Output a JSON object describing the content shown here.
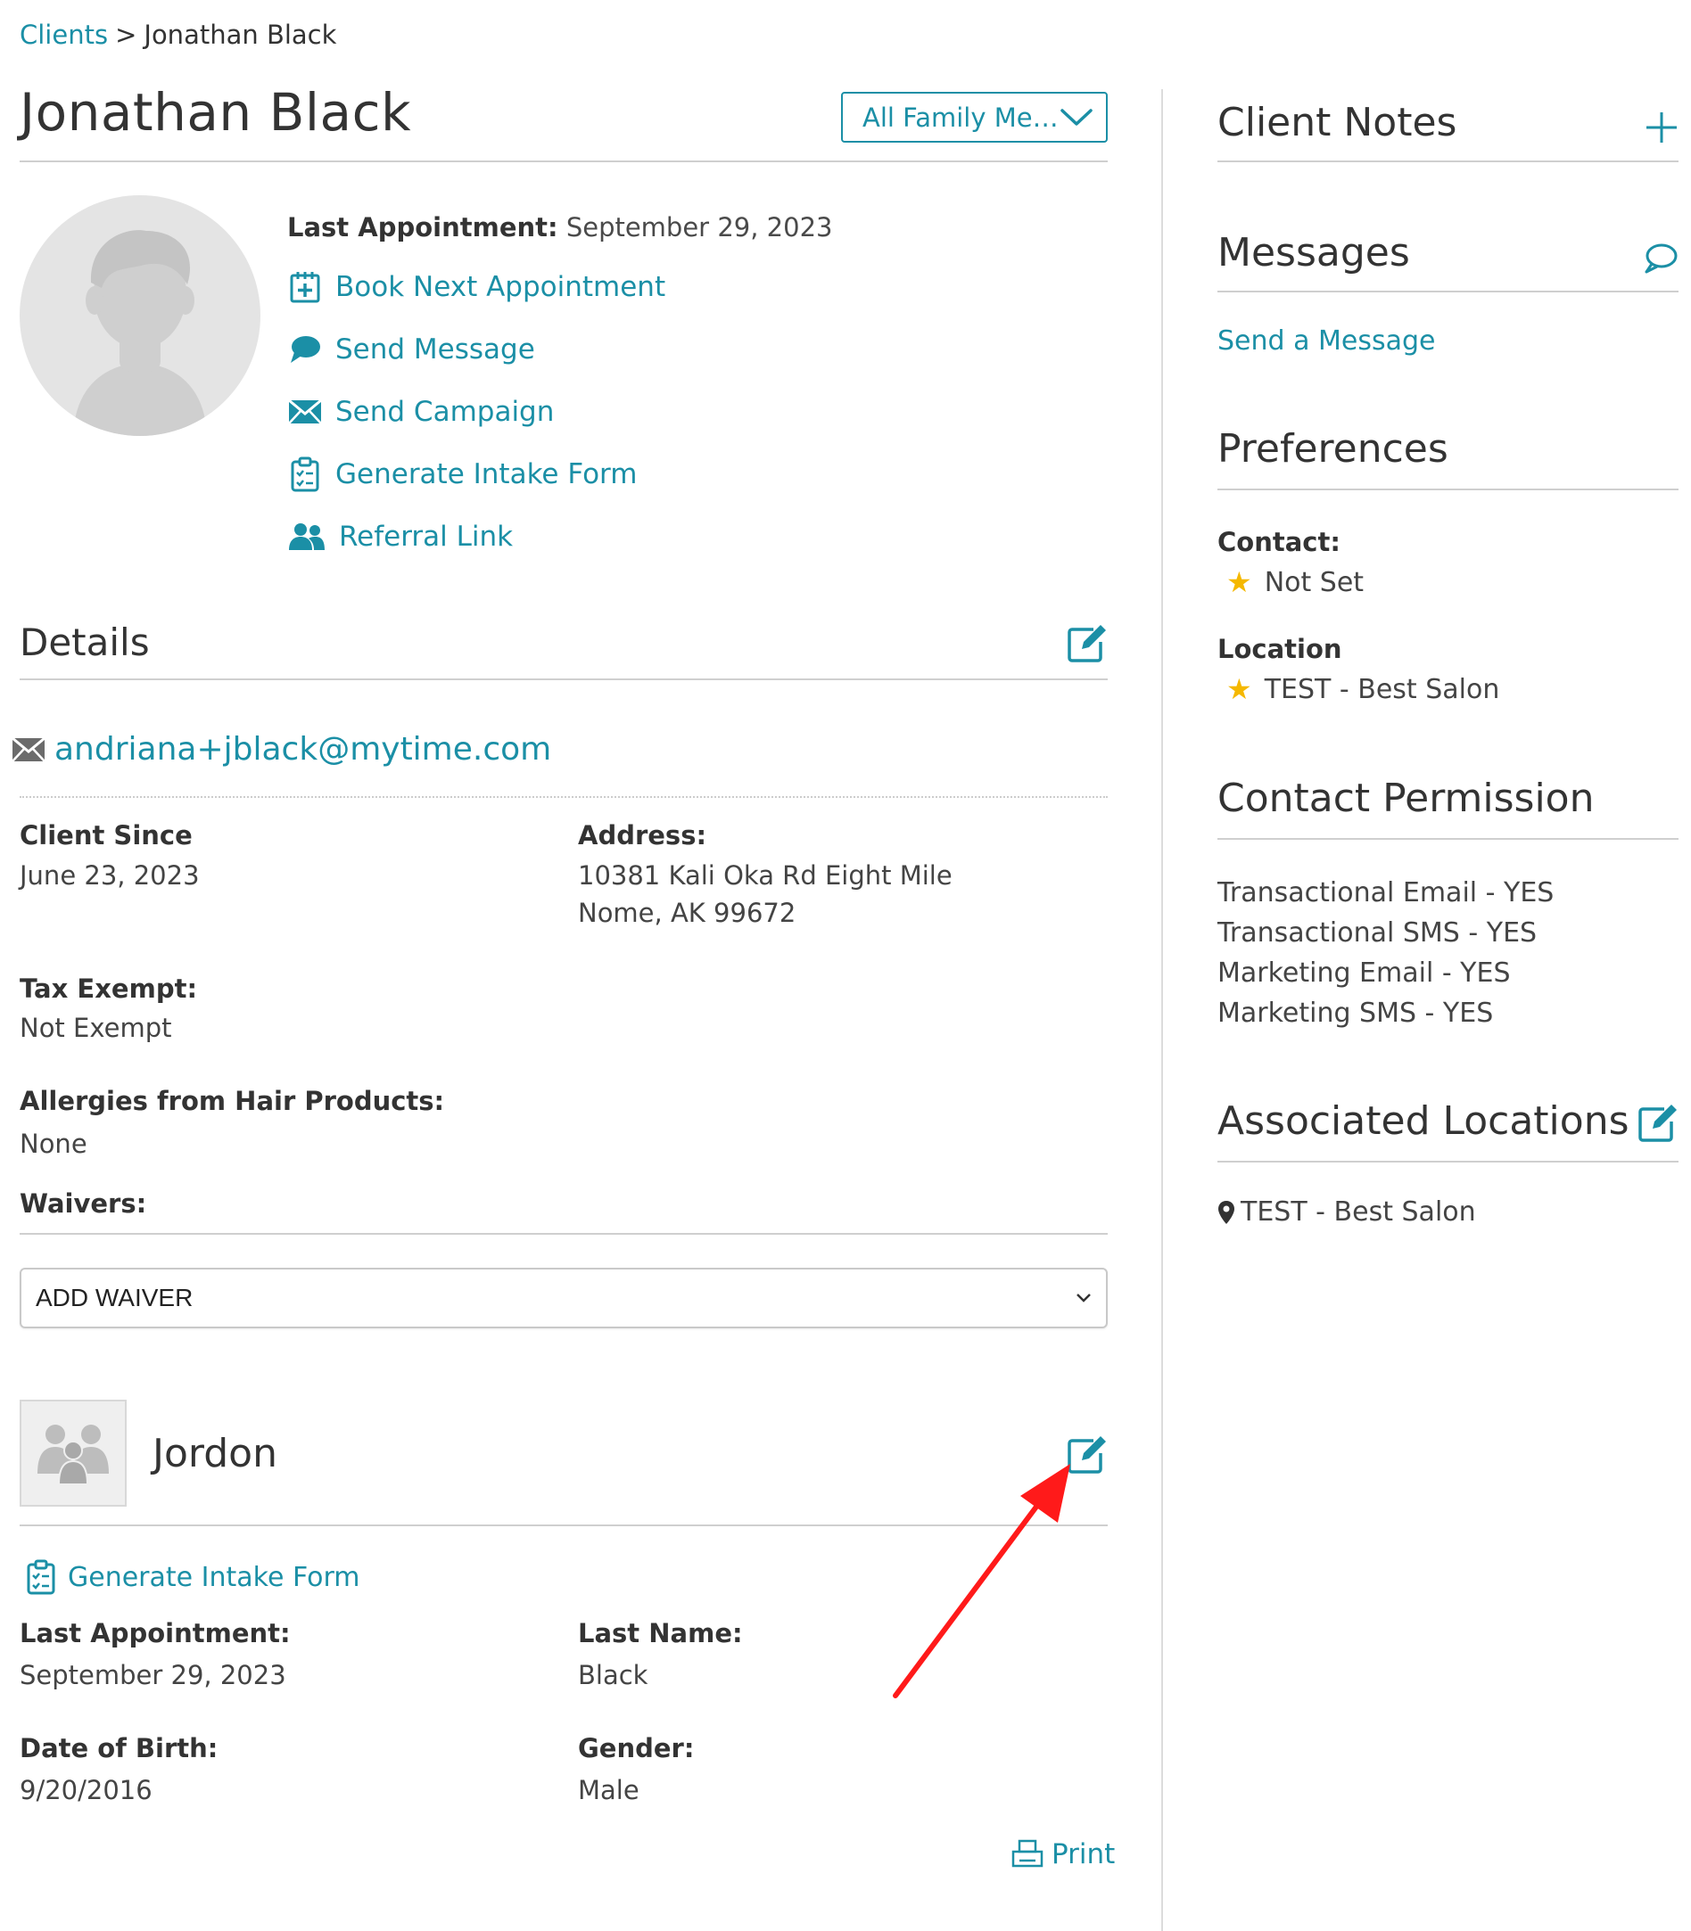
{
  "breadcrumb": {
    "parent": "Clients",
    "separator": ">",
    "current": "Jonathan Black"
  },
  "client": {
    "name": "Jonathan Black",
    "family_select": "All Family Me…",
    "last_appointment_label": "Last Appointment:",
    "last_appointment_value": "September 29, 2023"
  },
  "actions": [
    {
      "label": "Book Next Appointment",
      "icon": "calendar-plus-icon"
    },
    {
      "label": "Send Message",
      "icon": "chat-bubble-icon"
    },
    {
      "label": "Send Campaign",
      "icon": "envelope-icon"
    },
    {
      "label": "Generate Intake Form",
      "icon": "clipboard-icon"
    },
    {
      "label": "Referral Link",
      "icon": "users-icon"
    }
  ],
  "details": {
    "title": "Details",
    "email": "andriana+jblack@mytime.com",
    "client_since_label": "Client Since",
    "client_since_value": "June 23, 2023",
    "address_label": "Address:",
    "address_line1": "10381 Kali Oka Rd Eight Mile",
    "address_line2": "Nome, AK 99672",
    "tax_exempt_label": "Tax Exempt:",
    "tax_exempt_value": "Not Exempt",
    "allergies_label": "Allergies from Hair Products:",
    "allergies_value": "None",
    "waivers_label": "Waivers:",
    "waiver_select": "ADD WAIVER"
  },
  "member": {
    "name": "Jordon",
    "intake_form": "Generate Intake Form",
    "last_appointment_label": "Last Appointment:",
    "last_appointment_value": "September 29, 2023",
    "last_name_label": "Last Name:",
    "last_name_value": "Black",
    "dob_label": "Date of Birth:",
    "dob_value": "9/20/2016",
    "gender_label": "Gender:",
    "gender_value": "Male",
    "print": "Print"
  },
  "sidebar": {
    "client_notes_title": "Client Notes",
    "messages_title": "Messages",
    "send_message_link": "Send a Message",
    "preferences_title": "Preferences",
    "contact_label": "Contact:",
    "contact_value": "Not Set",
    "location_label": "Location",
    "location_value": "TEST - Best Salon",
    "contact_permission_title": "Contact Permission",
    "permissions": [
      "Transactional Email - YES",
      "Transactional SMS - YES",
      "Marketing Email - YES",
      "Marketing SMS - YES"
    ],
    "associated_locations_title": "Associated Locations",
    "associated_location": "TEST - Best Salon"
  },
  "colors": {
    "accent": "#1b8fa6",
    "star": "#f5b800",
    "annotation_arrow": "#ff0000"
  }
}
